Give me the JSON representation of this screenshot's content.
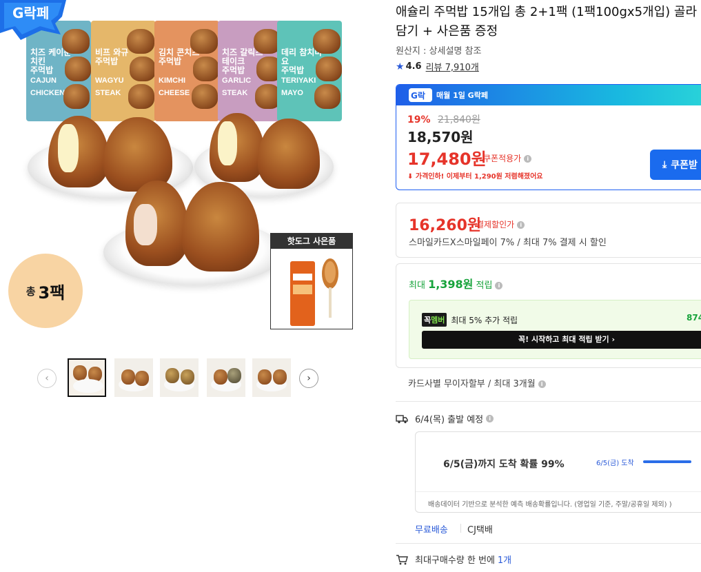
{
  "hero": {
    "badge_text": "G락페",
    "packs": [
      {
        "kr": "치즈 케이준치킨\n주먹밥",
        "en": "CAJUN\nCHICKEN",
        "color": "#6fb4c6"
      },
      {
        "kr": "비프 와규\n주먹밥",
        "en": "WAGYU\nSTEAK",
        "color": "#e5b76a"
      },
      {
        "kr": "김치 콘치즈\n주먹밥",
        "en": "KIMCHI\nCHEESE",
        "color": "#e4935f"
      },
      {
        "kr": "치즈 갈릭스테이크\n주먹밥",
        "en": "GARLIC\nSTEAK",
        "color": "#c89dc0"
      },
      {
        "kr": "데리 참치마요\n주먹밥",
        "en": "TERIYAKI\nMAYO",
        "color": "#5ec3b8"
      }
    ],
    "total_small": "총",
    "total_big": "3팩",
    "gift_title": "핫도그 사은품"
  },
  "thumbs": {
    "prev": "‹",
    "next": "›"
  },
  "product": {
    "title": "애슐리 주먹밥 15개입 총 2+1팩 (1팩100gx5개입) 골라담기 + 사은품 증정",
    "origin": "원산지 : 상세설명 참조",
    "rating": "4.6",
    "review": "리뷰 7,910개"
  },
  "gday": {
    "header": "매월 1일 G락페",
    "discount_pct": "19%",
    "orig_price": "21,840원",
    "sale_price": "18,570원",
    "coupon_price": "17,480원",
    "coupon_label": "쿠폰적용가",
    "price_drop": "가격인하! 이제부터 1,290원 저렴해졌어요",
    "coupon_btn": "쿠폰받"
  },
  "pay": {
    "price": "16,260원",
    "label": "결제할인가",
    "desc": "스마일카드X스마일페이 7% / 최대 7% 결제 시 할인"
  },
  "reward": {
    "prefix": "최대",
    "amount": "1,398원",
    "suffix": "적립",
    "member_tag_a": "꼭",
    "member_tag_b": "멤버",
    "member_text": "최대 5% 추가 적립",
    "member_amount": "874",
    "member_btn": "꼭! 시작하고 최대 적립 받기  ›"
  },
  "installment": "카드사별 무이자할부 / 최대 3개월",
  "shipping": {
    "depart": "6/4(목) 출발 예정",
    "arrive": "6/5(금)까지 도착 확률 99%",
    "arrive_date": "6/5(금) 도착",
    "note": "배송데이터 기반으로 분석한 예측 배송확률입니다. (영업일 기준, 주말/공휴일 제외) )",
    "free": "무료배송",
    "carrier": "CJ택배"
  },
  "max_purchase": {
    "label": "최대구매수량 한 번에",
    "value": "1개"
  }
}
